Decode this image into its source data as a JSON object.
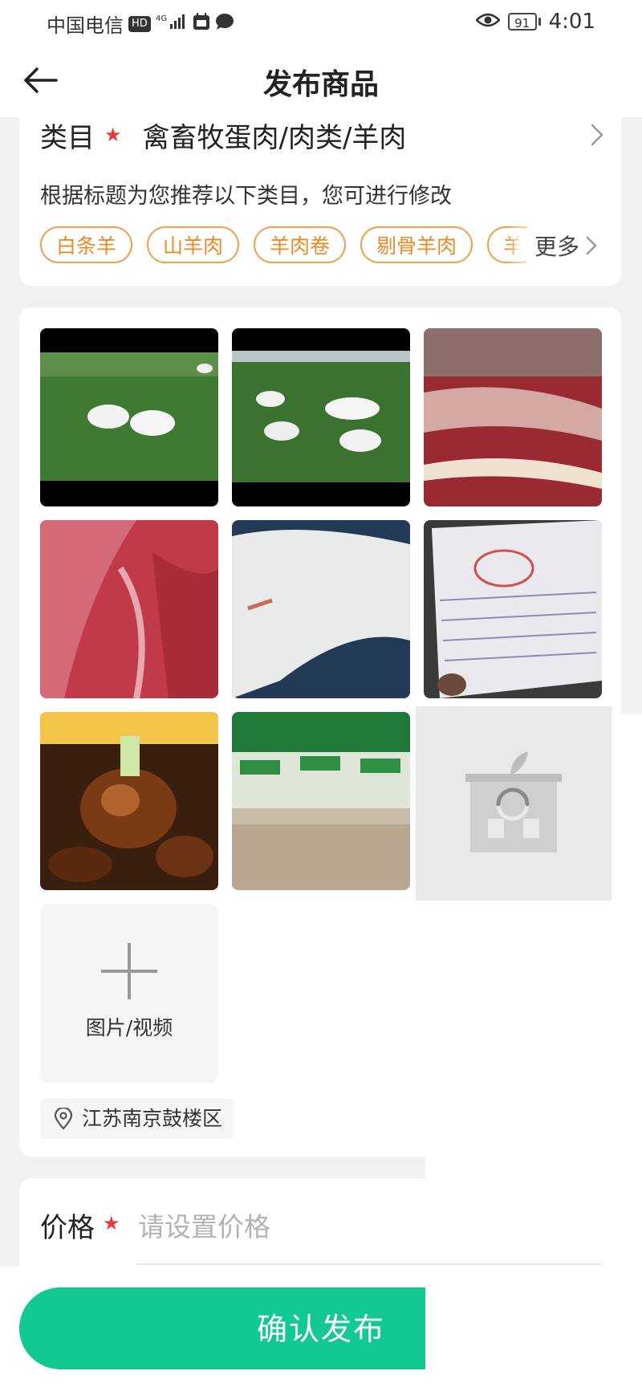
{
  "status_bar": {
    "carrier": "中国电信",
    "hd_badge": "HD",
    "network": "4G",
    "battery": "91",
    "time": "4:01"
  },
  "header": {
    "title": "发布商品",
    "back_icon": "arrow-left-icon"
  },
  "category": {
    "label": "类目",
    "required_mark": "★",
    "value": "禽畜牧蛋肉/肉类/羊肉",
    "hint": "根据标题为您推荐以下类目，您可进行修改",
    "tags": [
      "白条羊",
      "山羊肉",
      "羊肉卷",
      "剔骨羊肉",
      "羊"
    ],
    "more_label": "更多"
  },
  "media": {
    "add_label": "图片/视频",
    "location": "江苏南京鼓楼区"
  },
  "price": {
    "label": "价格",
    "required_mark": "★",
    "placeholder": "请设置价格"
  },
  "footer": {
    "publish_label": "确认发布"
  },
  "colors": {
    "accent": "#12c893",
    "tag_orange": "#e98a26",
    "required_red": "#e83a3a"
  }
}
